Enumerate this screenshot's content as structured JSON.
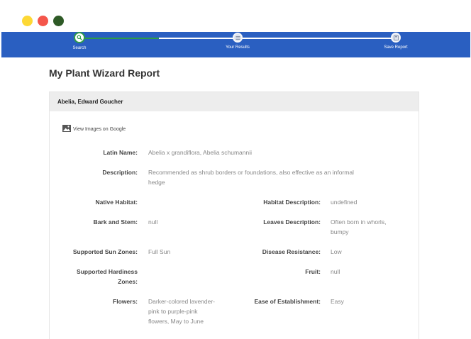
{
  "window": {
    "controls": [
      {
        "name": "minimize",
        "color": "#fdd835"
      },
      {
        "name": "close",
        "color": "#f4564b"
      },
      {
        "name": "maximize",
        "color": "#2e5a26"
      }
    ]
  },
  "steps": [
    {
      "label": "Search",
      "icon": "search-icon",
      "state": "active"
    },
    {
      "label": "Your Results",
      "icon": "list-icon",
      "state": "pending"
    },
    {
      "label": "Save Report",
      "icon": "save-icon",
      "state": "pending"
    }
  ],
  "page": {
    "title": "My Plant Wizard Report"
  },
  "plant": {
    "name": "Abelia, Edward Goucher",
    "image_link": "View Images on Google",
    "latin_name": {
      "label": "Latin Name:",
      "value": "Abelia x grandiflora, Abelia schumannii"
    },
    "description": {
      "label": "Description:",
      "value_line1": "Recommended as shrub borders or foundations, also effective as an informal",
      "value_line2": "hedge"
    },
    "native_habitat": {
      "label": "Native Habitat:",
      "value": ""
    },
    "habitat_description": {
      "label": "Habitat Description:",
      "value": "undefined"
    },
    "bark_and_stem": {
      "label": "Bark and Stem:",
      "value": "null"
    },
    "leaves_description": {
      "label": "Leaves Description:",
      "value_line1": "Often born in whorls,",
      "value_line2": "bumpy"
    },
    "sun_zones": {
      "label": "Supported Sun Zones:",
      "value": "Full Sun"
    },
    "disease_resistance": {
      "label": "Disease Resistance:",
      "value": "Low"
    },
    "hardiness_zones": {
      "label_line1": "Supported Hardiness",
      "label_line2": "Zones:",
      "value": ""
    },
    "fruit": {
      "label": "Fruit:",
      "value": "null"
    },
    "flowers": {
      "label": "Flowers:",
      "value_line1": "Darker-colored lavender-",
      "value_line2": "pink to purple-pink",
      "value_line3": "flowers, May to June"
    },
    "ease_of_establishment": {
      "label": "Ease of Establishment:",
      "value": "Easy"
    }
  }
}
